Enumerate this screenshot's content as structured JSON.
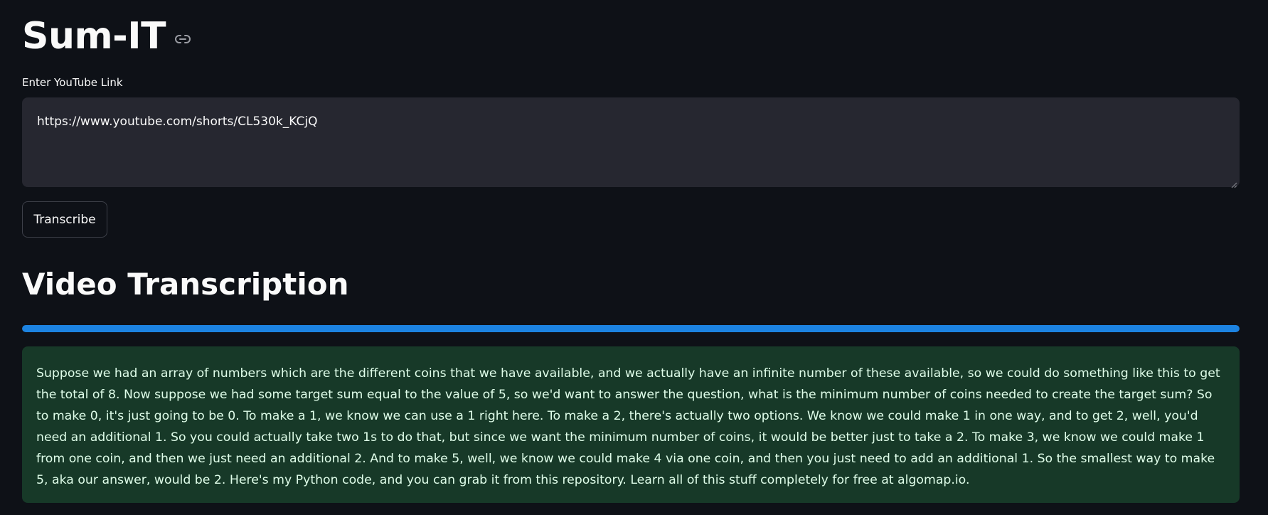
{
  "app": {
    "title": "Sum-IT"
  },
  "input": {
    "label": "Enter YouTube Link",
    "value": "https://www.youtube.com/shorts/CL530k_KCjQ"
  },
  "actions": {
    "transcribe_label": "Transcribe"
  },
  "transcription": {
    "heading": "Video Transcription",
    "progress": 1.0,
    "text": "Suppose we had an array of numbers which are the different coins that we have available, and we actually have an infinite number of these available, so we could do something like this to get the total of 8. Now suppose we had some target sum equal to the value of 5, so we'd want to answer the question, what is the minimum number of coins needed to create the target sum? So to make 0, it's just going to be 0. To make a 1, we know we can use a 1 right here. To make a 2, there's actually two options. We know we could make 1 in one way, and to get 2, well, you'd need an additional 1. So you could actually take two 1s to do that, but since we want the minimum number of coins, it would be better just to take a 2. To make 3, we know we could make 1 from one coin, and then we just need an additional 2. And to make 5, well, we know we could make 4 via one coin, and then you just need to add an additional 1. So the smallest way to make 5, aka our answer, would be 2. Here's my Python code, and you can grab it from this repository. Learn all of this stuff completely for free at algomap.io."
  },
  "colors": {
    "background": "#0e1117",
    "input_background": "#262730",
    "progress": "#1c83e1",
    "success_background": "#173928",
    "success_text": "#dffde9"
  },
  "icons": {
    "anchor": "link-icon",
    "resize": "resize-grip-icon"
  }
}
